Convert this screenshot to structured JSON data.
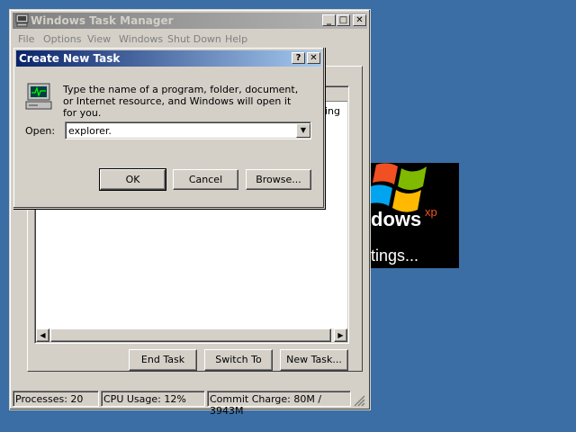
{
  "desktop": {
    "background": "#3a6ea5"
  },
  "task_manager": {
    "title": "Windows Task Manager",
    "menu": [
      "File",
      "Options",
      "View",
      "Windows",
      "Shut Down",
      "Help"
    ],
    "partial_column_text": "ing",
    "buttons": {
      "end_task": "End Task",
      "switch_to": "Switch To",
      "new_task": "New Task..."
    },
    "status": {
      "processes": "Processes: 20",
      "cpu": "CPU Usage: 12%",
      "commit": "Commit Charge: 80M / 3943M"
    }
  },
  "splash": {
    "brand": "dows",
    "superscript": "xp",
    "message": "tings..."
  },
  "dialog": {
    "title": "Create New Task",
    "help_symbol": "?",
    "close_symbol": "✕",
    "prompt": "Type the name of a program, folder, document, or Internet resource, and Windows will open it for you.",
    "open_label": "Open:",
    "open_value": "explorer.",
    "buttons": {
      "ok": "OK",
      "cancel": "Cancel",
      "browse": "Browse..."
    }
  },
  "caption_symbols": {
    "minimize": "_",
    "maximize": "□",
    "close": "✕"
  }
}
